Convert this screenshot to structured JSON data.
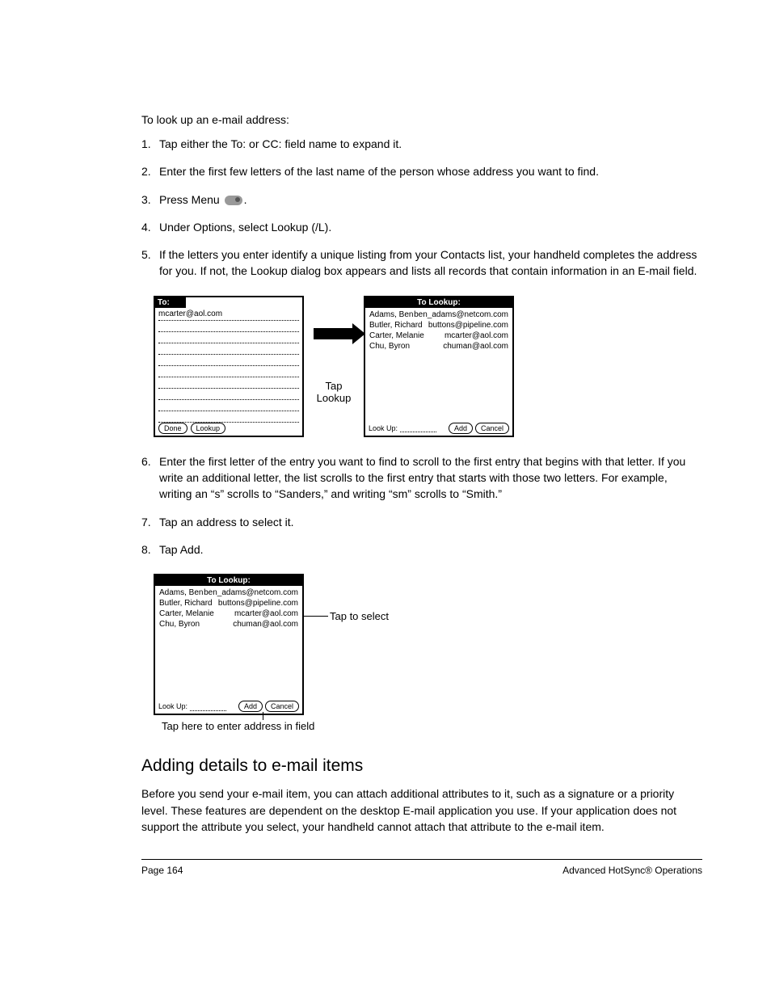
{
  "heading": "To look up an e-mail address:",
  "steps": [
    {
      "num": "1.",
      "text": "Tap either the To: or CC: field name to expand it."
    },
    {
      "num": "2.",
      "text": "Enter the first few letters of the last name of the person whose address you want to find."
    },
    {
      "num": "3.",
      "text_pre": "Press Menu ",
      "text_post": "."
    },
    {
      "num": "4.",
      "text": "Under Options, select Lookup (/L)."
    },
    {
      "num": "5.",
      "text": "If the letters you enter identify a unique listing from your Contacts list, your handheld completes the address for you. If not, the Lookup dialog box appears and lists all records that contain information in an E-mail field."
    }
  ],
  "screen1": {
    "title": "To:",
    "line1": "mcarter@aol.com",
    "done": "Done",
    "lookup": "Lookup"
  },
  "arrow_label_line1": "Tap",
  "arrow_label_line2": "Lookup",
  "screen2": {
    "title": "To Lookup:",
    "rows": [
      {
        "name": "Adams, Ben",
        "email": "ben_adams@netcom.com"
      },
      {
        "name": "Butler, Richard",
        "email": "buttons@pipeline.com"
      },
      {
        "name": "Carter, Melanie",
        "email": "mcarter@aol.com"
      },
      {
        "name": "Chu, Byron",
        "email": "chuman@aol.com"
      }
    ],
    "lookup_label": "Look Up:",
    "add": "Add",
    "cancel": "Cancel"
  },
  "steps2": [
    {
      "num": "6.",
      "text": "Enter the first letter of the entry you want to find to scroll to the first entry that begins with that letter. If you write an additional letter, the list scrolls to the first entry that starts with those two letters. For example, writing an “s” scrolls to “Sanders,” and writing “sm” scrolls to “Smith.”"
    },
    {
      "num": "7.",
      "text": "Tap an address to select it."
    },
    {
      "num": "8.",
      "text": "Tap Add."
    }
  ],
  "annot_select": "Tap to select",
  "caption_below": "Tap here to enter address in field",
  "section_heading": "Adding details to e-mail items",
  "body_para": "Before you send your e-mail item, you can attach additional attributes to it, such as a signature or a priority level. These features are dependent on the desktop E-mail application you use. If your application does not support the attribute you select, your handheld cannot attach that attribute to the e-mail item.",
  "footer_left": "Page 164",
  "footer_right": "Advanced HotSync® Operations"
}
